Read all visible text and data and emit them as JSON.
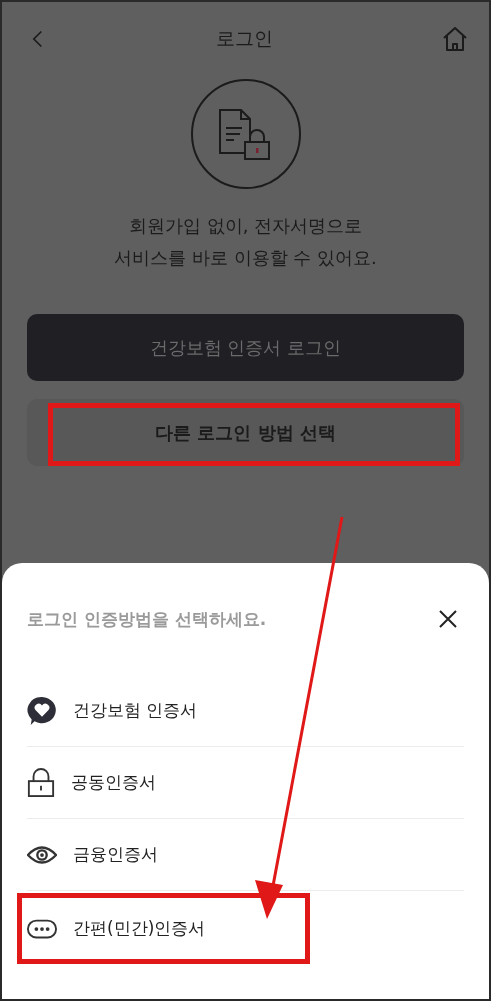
{
  "header": {
    "title": "로그인"
  },
  "intro": {
    "lines": [
      "회원가입 없이, 전자서명으로",
      "서비스를 바로 이용할 수 있어요."
    ]
  },
  "buttons": [
    {
      "label": "건강보험 인증서 로그인",
      "kind": "primary",
      "highlighted": false
    },
    {
      "label": "다른 로그인 방법 선택",
      "kind": "secondary",
      "highlighted": true
    }
  ],
  "sheet": {
    "title": "로그인 인증방법을 선택하세요.",
    "items": [
      {
        "label": "건강보험 인증서",
        "kind": "heart",
        "highlighted": false
      },
      {
        "label": "공동인증서",
        "kind": "lock",
        "highlighted": false
      },
      {
        "label": "금융인증서",
        "kind": "eye",
        "highlighted": false
      },
      {
        "label": "간편(민간)인증서",
        "kind": "dots",
        "highlighted": true
      }
    ]
  }
}
